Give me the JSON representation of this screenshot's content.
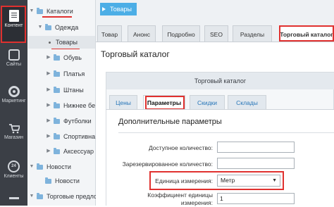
{
  "rail": {
    "items": [
      {
        "label": "Контент",
        "icon": "document-icon"
      },
      {
        "label": "Сайты",
        "icon": "sites-icon"
      },
      {
        "label": "Маркетинг",
        "icon": "target-icon"
      },
      {
        "label": "Магазин",
        "icon": "cart-icon"
      },
      {
        "label": "Клиенты",
        "icon": "clock-24-icon"
      },
      {
        "label": "",
        "icon": "more-icon"
      }
    ]
  },
  "tree": {
    "items": [
      {
        "label": "Каталоги",
        "level": 0,
        "expanded": true
      },
      {
        "label": "Одежда",
        "level": 1,
        "expanded": true
      },
      {
        "label": "Товары",
        "level": 2,
        "active": true
      },
      {
        "label": "Обувь",
        "level": 2
      },
      {
        "label": "Платья",
        "level": 2
      },
      {
        "label": "Штаны",
        "level": 2
      },
      {
        "label": "Нижнее бе",
        "level": 2
      },
      {
        "label": "Футболки",
        "level": 2
      },
      {
        "label": "Спортивна",
        "level": 2
      },
      {
        "label": "Аксессуар",
        "level": 2
      },
      {
        "label": "Новости",
        "level": 0
      },
      {
        "label": "Новости",
        "level": 1
      },
      {
        "label": "Торговые предло",
        "level": 0
      }
    ]
  },
  "breadcrumb": "Товары",
  "tabs": [
    "Товар",
    "Анонс",
    "Подробно",
    "SEO",
    "Разделы",
    "Торговый каталог"
  ],
  "section_title": "Торговый каталог",
  "inner_header": "Торговый каталог",
  "subtabs": [
    "Цены",
    "Параметры",
    "Скидки",
    "Склады"
  ],
  "additional_title": "Дополнительные параметры",
  "fields": {
    "available_label": "Доступное количество:",
    "available_value": "",
    "reserved_label": "Зарезервированное количество:",
    "reserved_value": "",
    "unit_label": "Единица измерения:",
    "unit_value": "Метр",
    "ratio_label_line1": "Коэффициент единицы",
    "ratio_label_line2": "измерения:",
    "ratio_value": "1"
  },
  "colors": {
    "highlight": "#e0312f",
    "accent": "#4caee6",
    "rail": "#3b3f46"
  }
}
